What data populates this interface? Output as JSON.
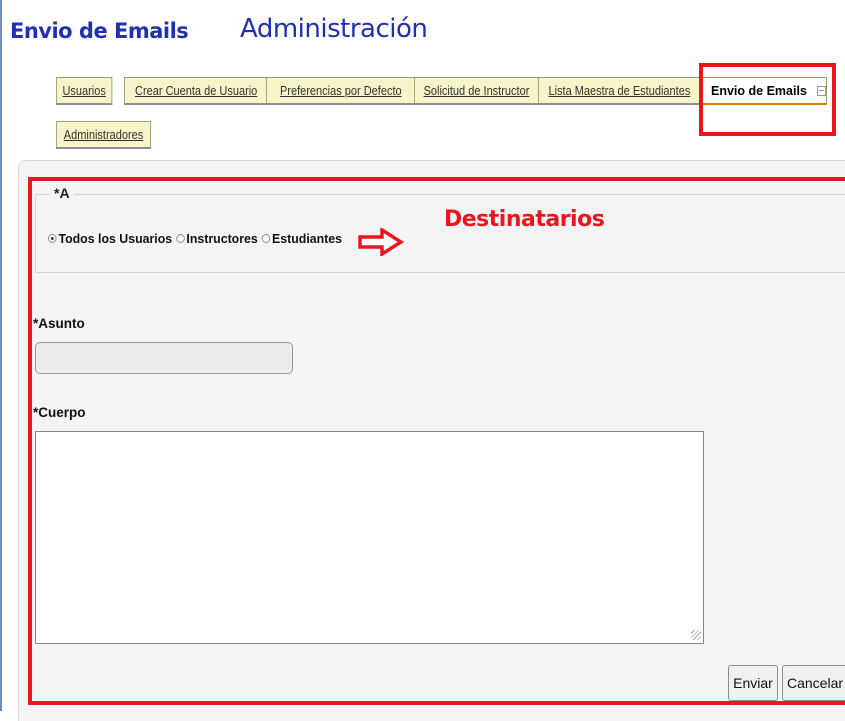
{
  "header": {
    "page_title": "Envio de Emails",
    "section_title": "Administración"
  },
  "tabs": [
    {
      "label": "Usuarios",
      "active": false
    },
    {
      "label": "Crear Cuenta de Usuario",
      "active": false
    },
    {
      "label": "Preferencias por Defecto",
      "active": false
    },
    {
      "label": "Solicitud de Instructor",
      "active": false
    },
    {
      "label": "Lista Maestra de Estudiantes",
      "active": false
    },
    {
      "label": "Envio de Emails",
      "active": true
    },
    {
      "label": "Administradores",
      "active": false
    }
  ],
  "form": {
    "recipients_legend": "*A",
    "recipients": [
      {
        "label": "Todos los Usuarios",
        "checked": true
      },
      {
        "label": "Instructores",
        "checked": false
      },
      {
        "label": "Estudiantes",
        "checked": false
      }
    ],
    "subject_label": "*Asunto",
    "subject_value": "",
    "body_label": "*Cuerpo",
    "body_value": ""
  },
  "buttons": {
    "send": "Enviar",
    "cancel": "Cancelar"
  },
  "annotation": {
    "label": "Destinatarios",
    "color": "#e8161f"
  },
  "icons": {
    "collapse_tab": "collapse-icon",
    "annotation_arrow": "arrow-right-icon"
  }
}
